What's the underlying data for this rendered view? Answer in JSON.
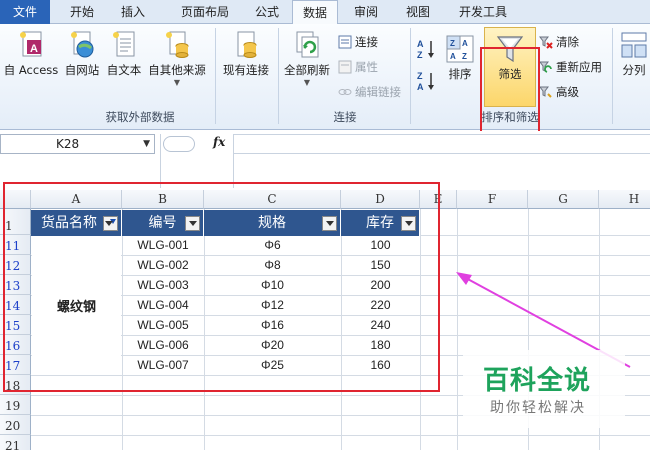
{
  "ribbon_tabs": [
    "文件",
    "开始",
    "插入",
    "页面布局",
    "公式",
    "数据",
    "审阅",
    "视图",
    "开发工具"
  ],
  "active_tab": "数据",
  "groups": {
    "external": {
      "label": "获取外部数据",
      "from_access": "自 Access",
      "from_web": "自网站",
      "from_text": "自文本",
      "from_other": "自其他来源",
      "existing": "现有连接"
    },
    "connections": {
      "label": "连接",
      "refresh_all": "全部刷新",
      "connections": "连接",
      "properties": "属性",
      "edit_links": "编辑链接"
    },
    "sort_filter": {
      "label": "排序和筛选",
      "sort": "排序",
      "filter": "筛选",
      "clear": "清除",
      "reapply": "重新应用",
      "advanced": "高级"
    },
    "tools": {
      "text_to_columns": "分列"
    }
  },
  "formula_bar": {
    "name_box": "K28",
    "fx": "fx",
    "formula": ""
  },
  "columns": [
    "A",
    "B",
    "C",
    "D",
    "E",
    "F",
    "G",
    "H"
  ],
  "row_numbers": [
    "1",
    "11",
    "12",
    "13",
    "14",
    "15",
    "16",
    "17",
    "18",
    "19",
    "20",
    "21"
  ],
  "table": {
    "headers": [
      "货品名称",
      "编号",
      "规格",
      "库存"
    ],
    "merged_product": "螺纹钢",
    "rows": [
      [
        "WLG-001",
        "Φ6",
        "100"
      ],
      [
        "WLG-002",
        "Φ8",
        "150"
      ],
      [
        "WLG-003",
        "Φ10",
        "200"
      ],
      [
        "WLG-004",
        "Φ12",
        "220"
      ],
      [
        "WLG-005",
        "Φ16",
        "240"
      ],
      [
        "WLG-006",
        "Φ20",
        "180"
      ],
      [
        "WLG-007",
        "Φ25",
        "160"
      ]
    ]
  },
  "watermark": {
    "title": "百科全说",
    "subtitle": "助你轻松解决"
  },
  "colors": {
    "table_header": "#2f568f",
    "highlight_box": "#e02530",
    "arrow": "#e040e0",
    "watermark": "#1ea35c",
    "filtered_row_number": "#1d40c9"
  }
}
